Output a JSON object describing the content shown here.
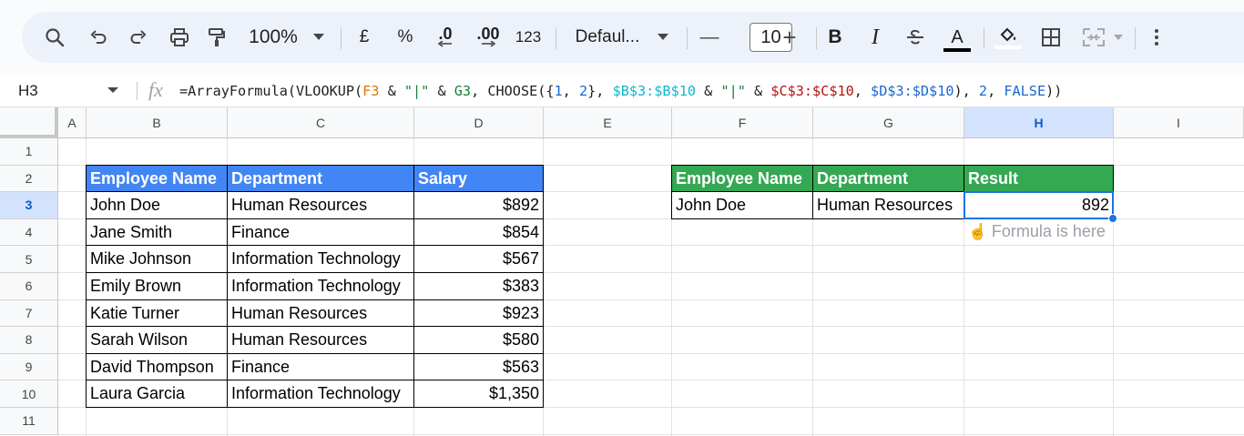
{
  "toolbar": {
    "zoom": "100%",
    "currency": "£",
    "percent": "%",
    "decrease_decimal": ".0",
    "increase_decimal": ".00",
    "more_formats": "123",
    "font": "Defaul...",
    "minus": "—",
    "font_size": "10",
    "plus": "+",
    "bold": "B",
    "italic": "I",
    "text_color_letter": "A"
  },
  "formula_bar": {
    "cell_ref": "H3",
    "fx": "fx",
    "formula_parts": [
      {
        "text": "=ArrayFormula(VLOOKUP(",
        "color": "#1f1f1f"
      },
      {
        "text": "F3",
        "color": "#e37400"
      },
      {
        "text": " & ",
        "color": "#1f1f1f"
      },
      {
        "text": "\"|\"",
        "color": "#188038"
      },
      {
        "text": " & ",
        "color": "#1f1f1f"
      },
      {
        "text": "G3",
        "color": "#188038"
      },
      {
        "text": ", CHOOSE({",
        "color": "#1f1f1f"
      },
      {
        "text": "1",
        "color": "#1967d2"
      },
      {
        "text": ", ",
        "color": "#1f1f1f"
      },
      {
        "text": "2",
        "color": "#1967d2"
      },
      {
        "text": "}, ",
        "color": "#1f1f1f"
      },
      {
        "text": "$B$3:$B$10",
        "color": "#12b5cb"
      },
      {
        "text": " & ",
        "color": "#1f1f1f"
      },
      {
        "text": "\"|\"",
        "color": "#188038"
      },
      {
        "text": " & ",
        "color": "#1f1f1f"
      },
      {
        "text": "$C$3:$C$10",
        "color": "#b31412"
      },
      {
        "text": ", ",
        "color": "#1f1f1f"
      },
      {
        "text": "$D$3:$D$10",
        "color": "#1967d2"
      },
      {
        "text": "), ",
        "color": "#1f1f1f"
      },
      {
        "text": "2",
        "color": "#1967d2"
      },
      {
        "text": ", ",
        "color": "#1f1f1f"
      },
      {
        "text": "FALSE",
        "color": "#1967d2"
      },
      {
        "text": "))",
        "color": "#1f1f1f"
      }
    ]
  },
  "columns": [
    "A",
    "B",
    "C",
    "D",
    "E",
    "F",
    "G",
    "H",
    "I"
  ],
  "rows": [
    "1",
    "2",
    "3",
    "4",
    "5",
    "6",
    "7",
    "8",
    "9",
    "10",
    "11"
  ],
  "selected_cell": "H3",
  "source_table": {
    "headers": [
      "Employee Name",
      "Department",
      "Salary"
    ],
    "rows": [
      [
        "John Doe",
        "Human Resources",
        "$892"
      ],
      [
        "Jane Smith",
        "Finance",
        "$854"
      ],
      [
        "Mike Johnson",
        "Information Technology",
        "$567"
      ],
      [
        "Emily Brown",
        "Information Technology",
        "$383"
      ],
      [
        "Katie Turner",
        "Human Resources",
        "$923"
      ],
      [
        "Sarah Wilson",
        "Human Resources",
        "$580"
      ],
      [
        "David Thompson",
        "Finance",
        "$563"
      ],
      [
        "Laura Garcia",
        "Information Technology",
        "$1,350"
      ]
    ]
  },
  "lookup_table": {
    "headers": [
      "Employee Name",
      "Department",
      "Result"
    ],
    "row": [
      "John Doe",
      "Human Resources",
      "892"
    ],
    "note": "Formula is here",
    "note_icon": "pointing-up-hand-icon"
  },
  "colors": {
    "blue_header": "#4285f4",
    "green_header": "#34a853",
    "selection": "#1a73e8"
  }
}
